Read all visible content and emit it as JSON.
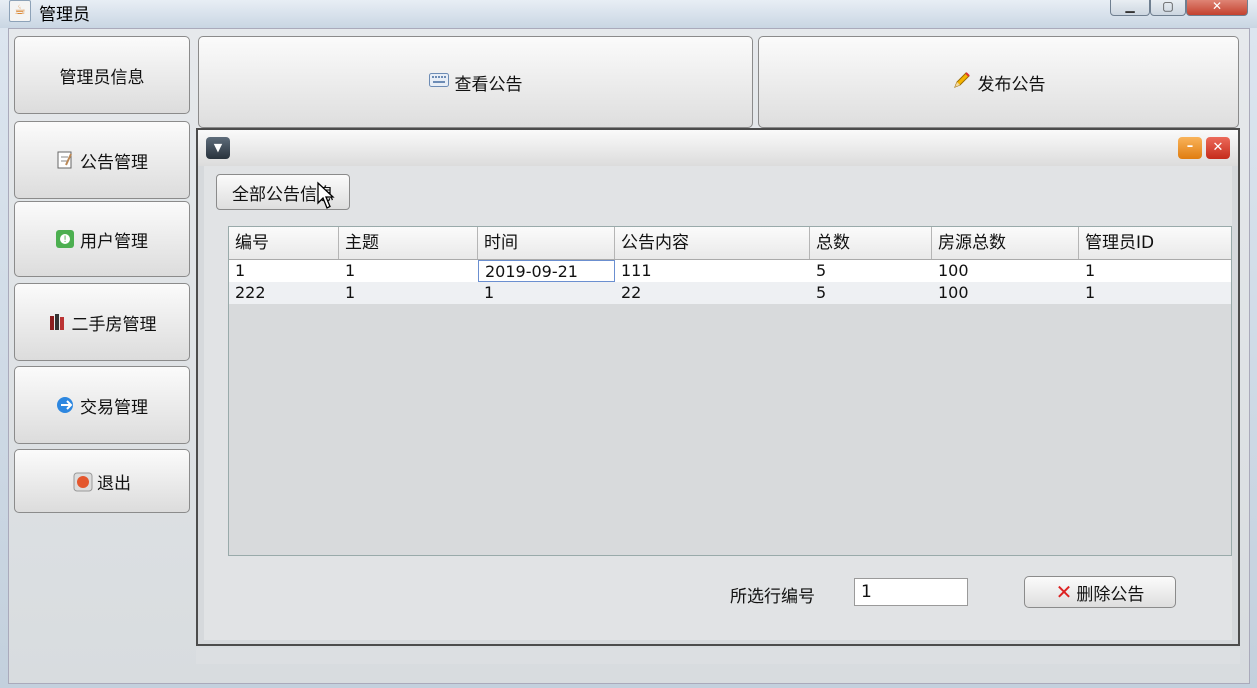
{
  "window": {
    "title": "管理员",
    "app_icon": "java-icon"
  },
  "sidebar": {
    "items": [
      {
        "label": "管理员信息",
        "icon": ""
      },
      {
        "label": "公告管理",
        "icon": "notepad-icon"
      },
      {
        "label": "用户管理",
        "icon": "user-icon"
      },
      {
        "label": "二手房管理",
        "icon": "books-icon"
      },
      {
        "label": "交易管理",
        "icon": "arrow-icon"
      },
      {
        "label": "退出",
        "icon": "stop-icon"
      }
    ]
  },
  "top_tabs": {
    "view": {
      "label": "查看公告",
      "icon": "keyboard-icon"
    },
    "publish": {
      "label": "发布公告",
      "icon": "pencil-icon"
    }
  },
  "internal_frame": {
    "all_button": "全部公告信息",
    "table": {
      "columns": [
        "编号",
        "主题",
        "时间",
        "公告内容",
        "总数",
        "房源总数",
        "管理员ID"
      ],
      "rows": [
        [
          "1",
          "1",
          "2019-09-21",
          "111",
          "5",
          "100",
          "1"
        ],
        [
          "222",
          "1",
          "1",
          "22",
          "5",
          "100",
          "1"
        ]
      ]
    },
    "selected_label": "所选行编号",
    "selected_value": "1",
    "delete_button": "删除公告"
  },
  "colors": {
    "delete_x": "#dd2222",
    "frame_border": "#4c4c4c"
  }
}
